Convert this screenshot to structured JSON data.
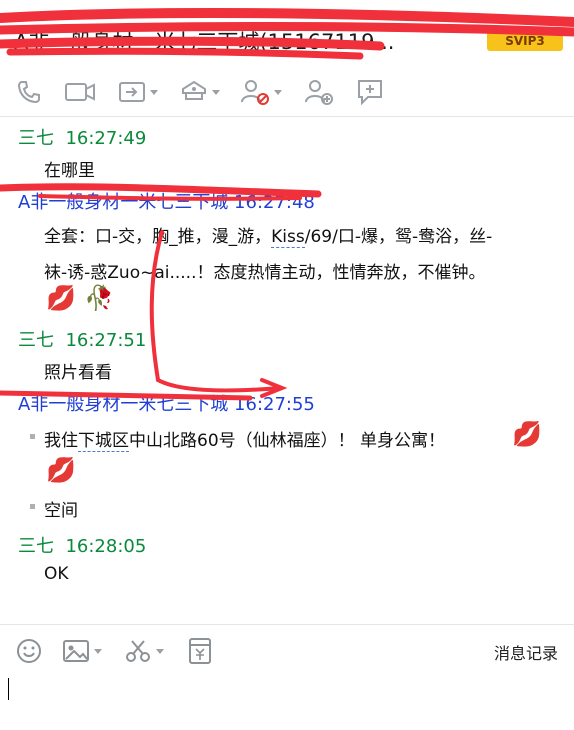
{
  "window": {
    "title": "A非一般身材一米七三下城(15167119...",
    "badge": "SVIP3"
  },
  "toolbar": {
    "icons": [
      "phone-icon",
      "video-icon",
      "share-screen-icon",
      "app-box-icon",
      "remove-user-icon",
      "add-user-icon",
      "message-board-icon"
    ]
  },
  "messages": [
    {
      "sender": "三七",
      "time": "16:27:49",
      "text": "在哪里"
    },
    {
      "sender": "A非一般身材一米七三下城",
      "time": "16:27:48",
      "line1_a": "全套：口-交，胸_推，漫_游，",
      "line1_link": "Kiss",
      "line1_b": "/69/口-爆，鸳-鸯浴，丝-",
      "line2": "袜-诱-惑Zuo~ai.....！态度热情主动，性情奔放，不催钟。",
      "emojis": [
        "💋",
        "🥀"
      ]
    },
    {
      "sender": "三七",
      "time": "16:27:51",
      "text": "照片看看"
    },
    {
      "sender": "A非一般身材一米七三下城",
      "time": "16:27:55",
      "bullet1_a": "我住",
      "bullet1_link": "下城区",
      "bullet1_b": "中山北路60号（仙林福座）！ 单身公寓！",
      "bullet2": "空间"
    },
    {
      "sender": "三七",
      "time": "16:28:05",
      "text": "OK"
    }
  ],
  "bottombar": {
    "history_label": "消息记录"
  },
  "colors": {
    "self_name": "#0a8a3a",
    "other_name": "#1f3fd6",
    "scribble": "#f0303a",
    "badge": "#f7c21a"
  }
}
